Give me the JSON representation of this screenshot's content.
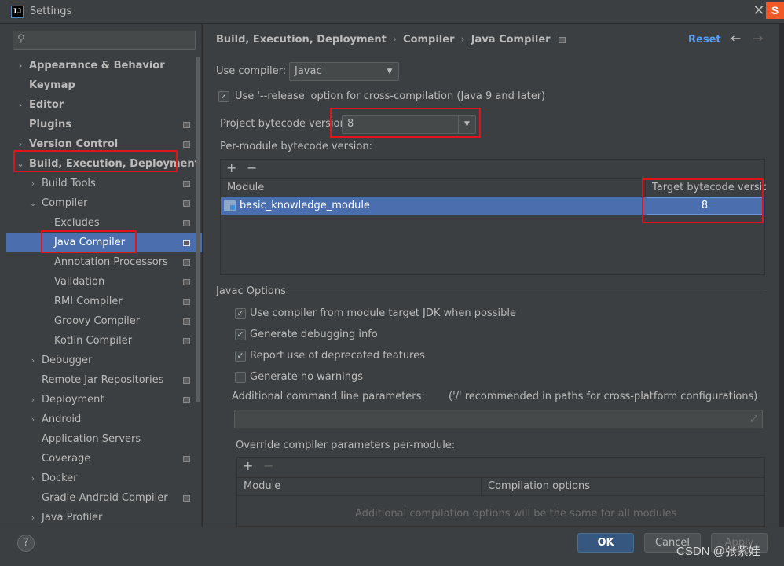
{
  "window": {
    "title": "Settings",
    "app_icon": "intellij-icon",
    "close_icon": "close-icon"
  },
  "sidebar": {
    "search_placeholder": "",
    "items": [
      {
        "label": "Appearance & Behavior",
        "arrow": "›",
        "bold": true
      },
      {
        "label": "Keymap",
        "arrow": "",
        "bold": true
      },
      {
        "label": "Editor",
        "arrow": "›",
        "bold": true
      },
      {
        "label": "Plugins",
        "arrow": "",
        "bold": true
      },
      {
        "label": "Version Control",
        "arrow": "›",
        "bold": true
      },
      {
        "label": "Build, Execution, Deployment",
        "arrow": "⌄",
        "bold": true
      },
      {
        "label": "Build Tools",
        "arrow": "›"
      },
      {
        "label": "Compiler",
        "arrow": "⌄"
      },
      {
        "label": "Excludes",
        "arrow": ""
      },
      {
        "label": "Java Compiler",
        "arrow": "",
        "selected": true
      },
      {
        "label": "Annotation Processors",
        "arrow": ""
      },
      {
        "label": "Validation",
        "arrow": ""
      },
      {
        "label": "RMI Compiler",
        "arrow": ""
      },
      {
        "label": "Groovy Compiler",
        "arrow": ""
      },
      {
        "label": "Kotlin Compiler",
        "arrow": ""
      },
      {
        "label": "Debugger",
        "arrow": "›"
      },
      {
        "label": "Remote Jar Repositories",
        "arrow": ""
      },
      {
        "label": "Deployment",
        "arrow": "›"
      },
      {
        "label": "Android",
        "arrow": "›"
      },
      {
        "label": "Application Servers",
        "arrow": ""
      },
      {
        "label": "Coverage",
        "arrow": ""
      },
      {
        "label": "Docker",
        "arrow": "›"
      },
      {
        "label": "Gradle-Android Compiler",
        "arrow": ""
      },
      {
        "label": "Java Profiler",
        "arrow": "›"
      }
    ]
  },
  "main": {
    "breadcrumb": [
      "Build, Execution, Deployment",
      "Compiler",
      "Java Compiler"
    ],
    "reset_label": "Reset",
    "use_compiler_label": "Use compiler:",
    "use_compiler_value": "Javac",
    "release_option_label": "Use '--release' option for cross-compilation (Java 9 and later)",
    "release_option_checked": true,
    "project_bytecode_label": "Project bytecode version:",
    "project_bytecode_value": "8",
    "per_module_label": "Per-module bytecode version:",
    "module_table": {
      "headers": [
        "Module",
        "Target bytecode version"
      ],
      "rows": [
        {
          "module": "basic_knowledge_module",
          "target": "8"
        }
      ]
    },
    "javac_options_title": "Javac Options",
    "options": [
      {
        "label": "Use compiler from module target JDK when possible",
        "checked": true
      },
      {
        "label": "Generate debugging info",
        "checked": true
      },
      {
        "label": "Report use of deprecated features",
        "checked": true
      },
      {
        "label": "Generate no warnings",
        "checked": false
      }
    ],
    "additional_params_label": "Additional command line parameters:",
    "additional_params_hint": "('/' recommended in paths for cross-platform configurations)",
    "additional_params_value": "",
    "override_label": "Override compiler parameters per-module:",
    "override_table": {
      "headers": [
        "Module",
        "Compilation options"
      ],
      "empty_text": "Additional compilation options will be the same for all modules"
    }
  },
  "footer": {
    "help_label": "?",
    "ok_label": "OK",
    "cancel_label": "Cancel",
    "apply_label": "Apply"
  },
  "watermark": "CSDN @张紫娃",
  "colors": {
    "accent": "#4b6eaf",
    "link": "#589df6",
    "highlight": "#e0151c",
    "ok_button": "#365880"
  }
}
